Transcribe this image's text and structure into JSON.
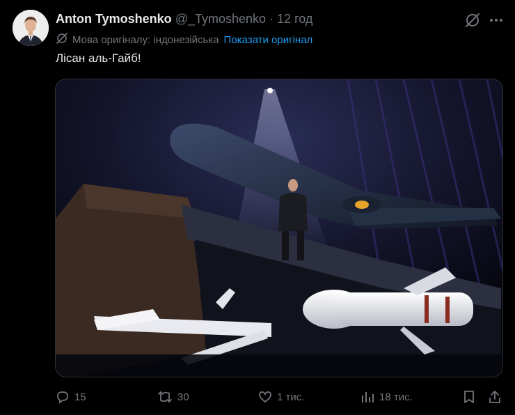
{
  "tweet": {
    "author_name": "Anton Tymoshenko",
    "handle": "@_Tymoshenko",
    "separator": "·",
    "time": "12 год",
    "translation": {
      "language_label": "Мова оригіналу: індонезійська",
      "show_original": "Показати оригінал"
    },
    "text": "Лісан аль-Гайб!"
  },
  "actions": {
    "replies": "15",
    "reposts": "30",
    "likes": "1 тис.",
    "views": "18 тис."
  },
  "icons": {
    "avatar": "avatar",
    "grok": "grok-icon",
    "more": "more-icon",
    "translate": "translate-icon",
    "reply": "reply-icon",
    "repost": "repost-icon",
    "like": "like-icon",
    "views": "views-icon",
    "bookmark": "bookmark-icon",
    "share": "share-icon"
  },
  "colors": {
    "background": "#000000",
    "text": "#e7e9ea",
    "muted": "#71767b",
    "link": "#1d9bf0",
    "border": "#2f3336"
  }
}
